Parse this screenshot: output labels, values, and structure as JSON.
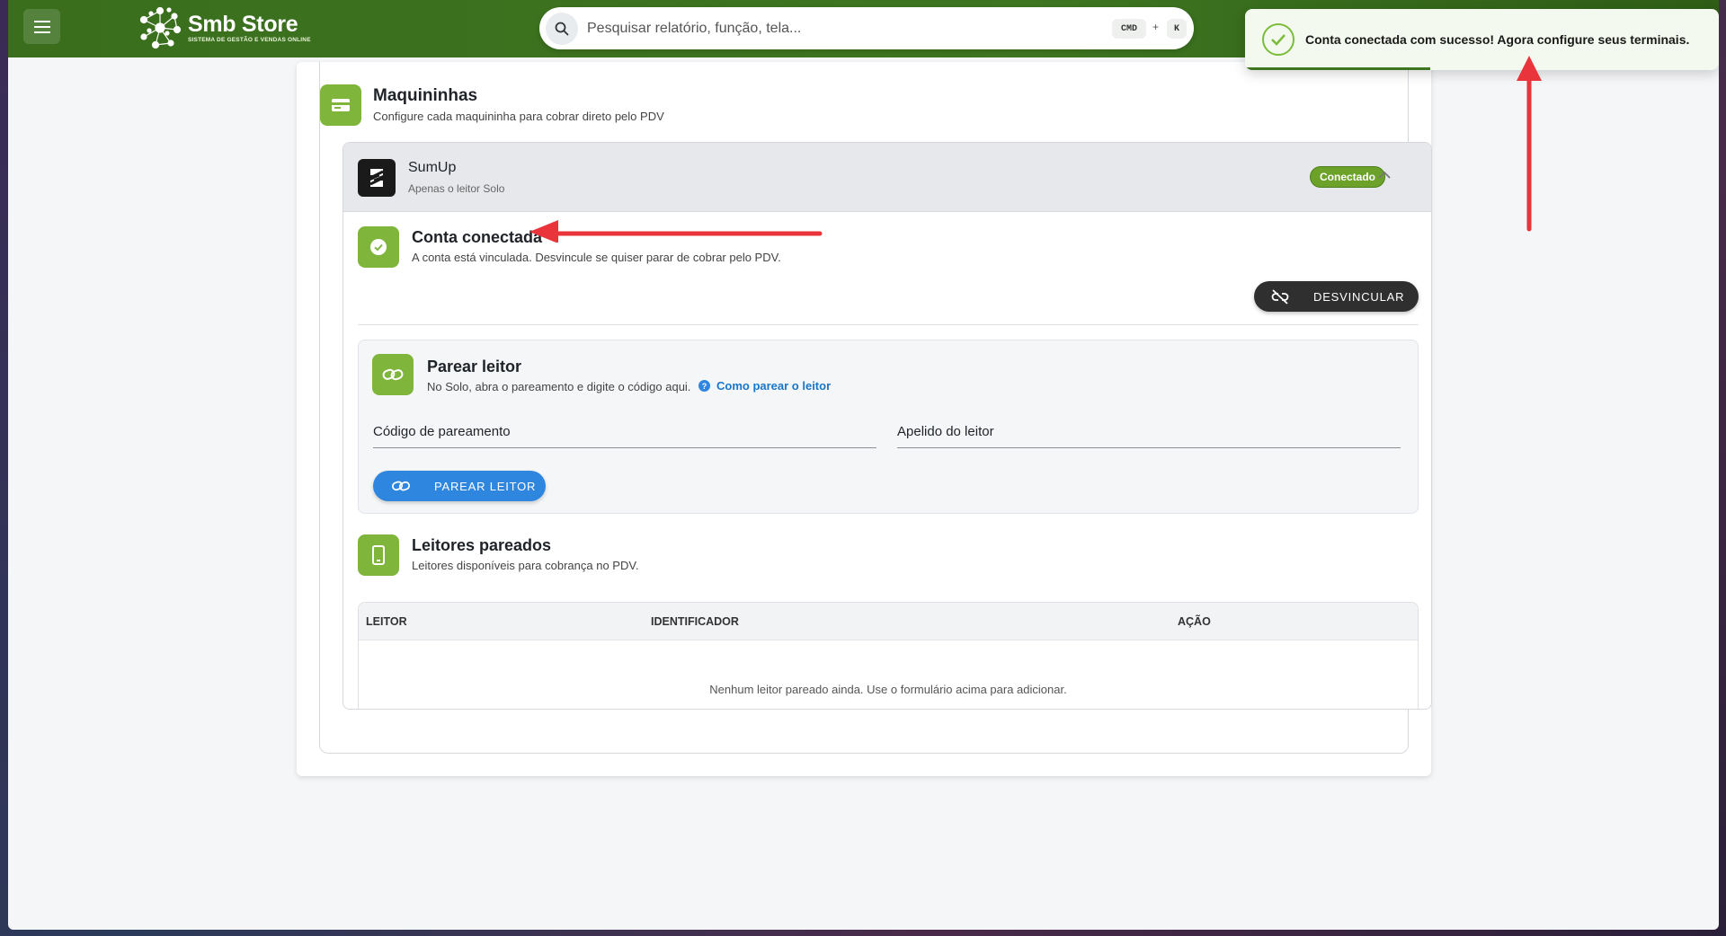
{
  "header": {
    "brand_name": "Smb Store",
    "brand_tagline": "SISTEMA DE GESTÃO E VENDAS ONLINE",
    "search_placeholder": "Pesquisar relatório, função, tela...",
    "shortcut_key1": "CMD",
    "shortcut_plus": "+",
    "shortcut_key2": "K"
  },
  "toast": {
    "message": "Conta conectada com sucesso! Agora configure seus terminais.",
    "progress": 0.39
  },
  "section": {
    "title": "Maquininhas",
    "subtitle": "Configure cada maquininha para cobrar direto pelo PDV"
  },
  "provider": {
    "name": "SumUp",
    "description": "Apenas o leitor Solo",
    "status_badge": "Conectado",
    "account": {
      "title": "Conta conectada",
      "description": "A conta está vinculada. Desvincule se quiser parar de cobrar pelo PDV.",
      "unlink_label": "DESVINCULAR"
    },
    "pair": {
      "title": "Parear leitor",
      "description": "No Solo, abra o pareamento e digite o código aqui.",
      "help_link": "Como parear o leitor",
      "code_label": "Código de pareamento",
      "nickname_label": "Apelido do leitor",
      "button_label": "PAREAR LEITOR"
    },
    "readers": {
      "title": "Leitores pareados",
      "description": "Leitores disponíveis para cobrança no PDV.",
      "columns": [
        "LEITOR",
        "IDENTIFICADOR",
        "AÇÃO"
      ],
      "rows": [],
      "empty_message": "Nenhum leitor pareado ainda. Use o formulário acima para adicionar."
    }
  },
  "colors": {
    "brand_green": "#3d7520",
    "accent_green": "#7fb53a",
    "badge_green": "#6ca22a",
    "primary_blue": "#2f86de",
    "annotation_red": "#e8343a"
  }
}
